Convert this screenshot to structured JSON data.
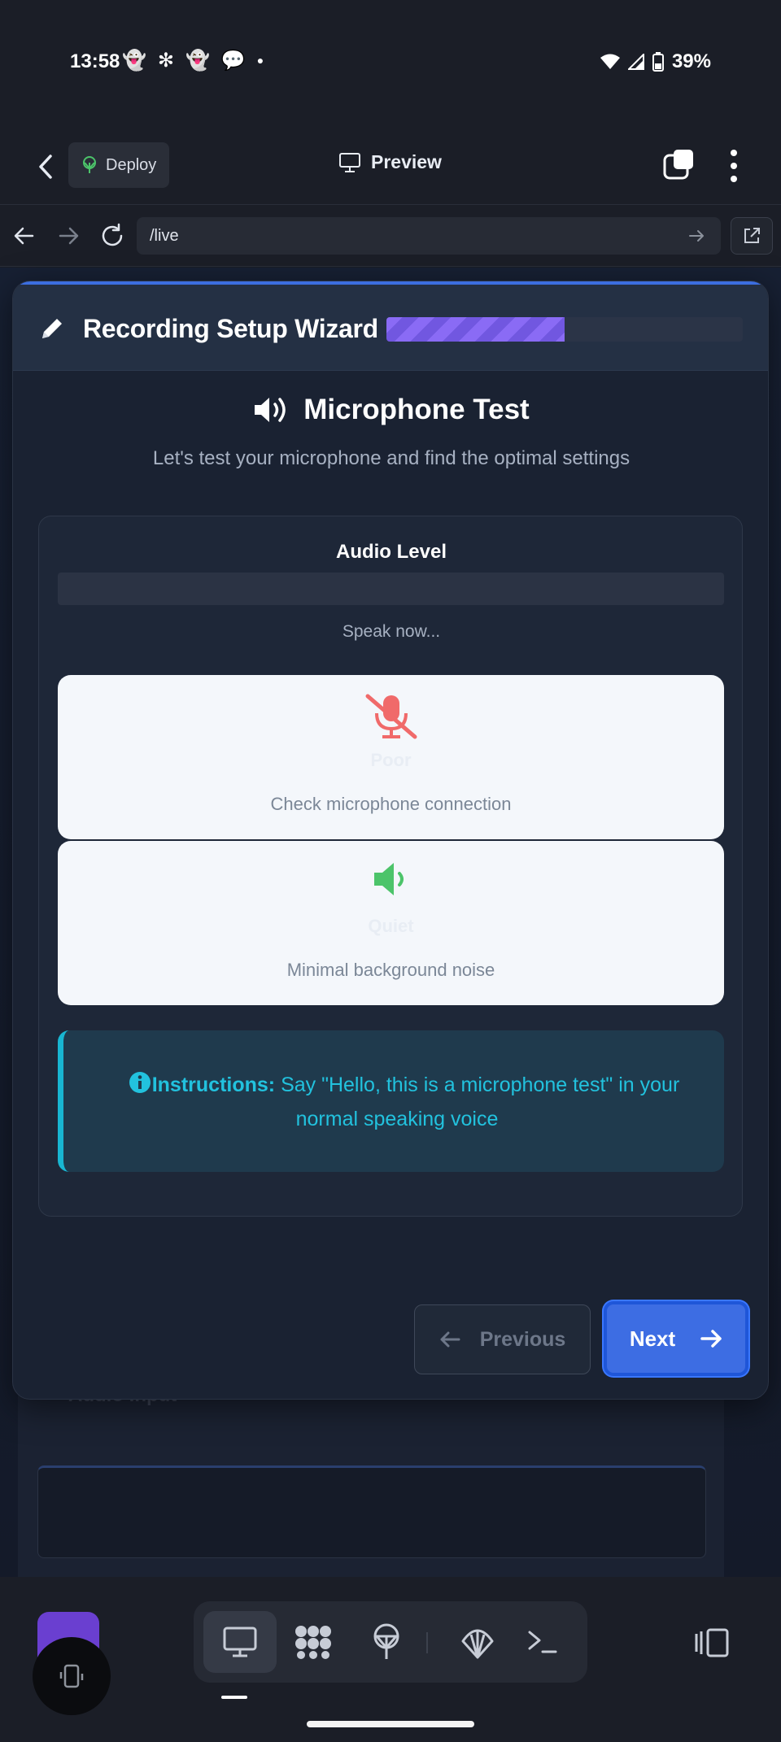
{
  "status_bar": {
    "time": "13:58",
    "battery": "39%"
  },
  "app_bar": {
    "deploy_label": "Deploy",
    "preview_label": "Preview"
  },
  "browser": {
    "url": "/live"
  },
  "background": {
    "audio_input_label": "Audio Input"
  },
  "wizard": {
    "title": "Recording Setup Wizard",
    "progress": 0.5,
    "section_title": "Microphone Test",
    "section_subtitle": "Let's test your microphone and find the optimal settings",
    "audio_level_label": "Audio Level",
    "audio_level": 0,
    "speak_prompt": "Speak now...",
    "cards": [
      {
        "status": "Poor",
        "description": "Check microphone connection",
        "icon": "microphone-slash-icon",
        "color": "#f06a6a"
      },
      {
        "status": "Quiet",
        "description": "Minimal background noise",
        "icon": "volume-low-icon",
        "color": "#4cc46a"
      }
    ],
    "instructions_label": "Instructions:",
    "instructions_text": "Say \"Hello, this is a microphone test\" in your normal speaking voice",
    "prev_label": "Previous",
    "next_label": "Next"
  },
  "colors": {
    "accent": "#3d6de3",
    "progress": "#8a6bf5",
    "info": "#22c2de"
  }
}
